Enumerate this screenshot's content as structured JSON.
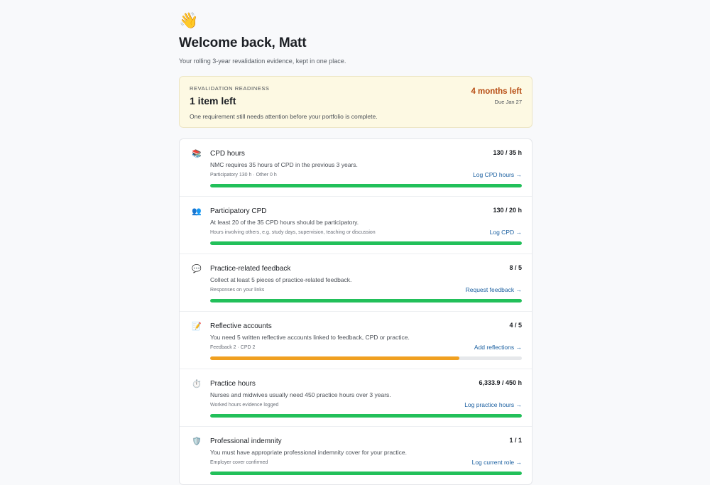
{
  "header": {
    "wave_emoji": "👋",
    "title": "Welcome back, Matt",
    "subtitle": "Your rolling 3-year revalidation evidence, kept in one place."
  },
  "readiness": {
    "label": "REVALIDATION READINESS",
    "count": "1 item left",
    "description": "One requirement still needs attention before your portfolio is complete.",
    "months_left": "4 months left",
    "due": "Due Jan 27",
    "accent_color": "#b64a10"
  },
  "colors": {
    "complete": "#22c05a",
    "partial": "#f0a020",
    "link": "#1a5fa0"
  },
  "requirements": [
    {
      "icon": "📚",
      "icon_name": "books-icon",
      "name": "CPD hours",
      "count": "130 / 35 h",
      "description": "NMC requires 35 hours of CPD in the previous 3 years.",
      "meta": "Participatory 130 h · Other 0 h",
      "link": "Log CPD hours →",
      "progress": 1.0,
      "status": "complete"
    },
    {
      "icon": "👥",
      "icon_name": "people-icon",
      "name": "Participatory CPD",
      "count": "130 / 20 h",
      "description": "At least 20 of the 35 CPD hours should be participatory.",
      "meta": "Hours involving others, e.g. study days, supervision, teaching or discussion",
      "link": "Log CPD →",
      "progress": 1.0,
      "status": "complete"
    },
    {
      "icon": "💬",
      "icon_name": "speech-bubble-icon",
      "name": "Practice-related feedback",
      "count": "8 / 5",
      "description": "Collect at least 5 pieces of practice-related feedback.",
      "meta": "Responses on your links",
      "link": "Request feedback →",
      "progress": 1.0,
      "status": "complete"
    },
    {
      "icon": "📝",
      "icon_name": "memo-icon",
      "name": "Reflective accounts",
      "count": "4 / 5",
      "description": "You need 5 written reflective accounts linked to feedback, CPD or practice.",
      "meta": "Feedback 2 · CPD 2",
      "link": "Add reflections →",
      "progress": 0.8,
      "status": "partial"
    },
    {
      "icon": "⏱️",
      "icon_name": "stopwatch-icon",
      "name": "Practice hours",
      "count": "6,333.9 / 450 h",
      "description": "Nurses and midwives usually need 450 practice hours over 3 years.",
      "meta": "Worked hours evidence logged",
      "link": "Log practice hours →",
      "progress": 1.0,
      "status": "complete"
    },
    {
      "icon": "🛡️",
      "icon_name": "shield-icon",
      "name": "Professional indemnity",
      "count": "1 / 1",
      "description": "You must have appropriate professional indemnity cover for your practice.",
      "meta": "Employer cover confirmed",
      "link": "Log current role →",
      "progress": 1.0,
      "status": "complete"
    }
  ]
}
